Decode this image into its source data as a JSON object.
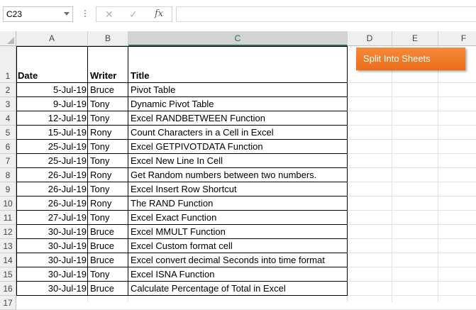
{
  "formula_bar": {
    "name_box": "C23",
    "cancel_icon": "close-icon",
    "enter_icon": "check-icon",
    "fx_label": "fx",
    "formula": ""
  },
  "columns": [
    "A",
    "B",
    "C",
    "D",
    "E",
    "F"
  ],
  "rows": [
    "1",
    "2",
    "3",
    "4",
    "5",
    "6",
    "7",
    "8",
    "9",
    "10",
    "11",
    "12",
    "13",
    "14",
    "15",
    "16",
    "17"
  ],
  "table": {
    "headers": {
      "date": "Date",
      "writer": "Writer",
      "title": "Title"
    },
    "records": [
      {
        "date": "5-Jul-19",
        "writer": "Bruce",
        "title": "Pivot Table"
      },
      {
        "date": "9-Jul-19",
        "writer": "Tony",
        "title": "Dynamic Pivot Table"
      },
      {
        "date": "12-Jul-19",
        "writer": "Tony",
        "title": "Excel RANDBETWEEN Function"
      },
      {
        "date": "15-Jul-19",
        "writer": "Rony",
        "title": "Count Characters in a Cell in Excel"
      },
      {
        "date": "25-Jul-19",
        "writer": "Tony",
        "title": "Excel GETPIVOTDATA Function"
      },
      {
        "date": "25-Jul-19",
        "writer": "Tony",
        "title": "Excel New Line In Cell"
      },
      {
        "date": "26-Jul-19",
        "writer": "Rony",
        "title": "Get Random numbers between two numbers."
      },
      {
        "date": "26-Jul-19",
        "writer": "Tony",
        "title": "Excel Insert Row Shortcut"
      },
      {
        "date": "26-Jul-19",
        "writer": "Rony",
        "title": "The RAND Function"
      },
      {
        "date": "27-Jul-19",
        "writer": "Tony",
        "title": "Excel Exact Function"
      },
      {
        "date": "30-Jul-19",
        "writer": "Bruce",
        "title": "Excel MMULT Function"
      },
      {
        "date": "30-Jul-19",
        "writer": "Bruce",
        "title": "Excel Custom format cell"
      },
      {
        "date": "30-Jul-19",
        "writer": "Bruce",
        "title": "Excel convert decimal Seconds into time format"
      },
      {
        "date": "30-Jul-19",
        "writer": "Tony",
        "title": "Excel ISNA Function"
      },
      {
        "date": "30-Jul-19",
        "writer": "Bruce",
        "title": "Calculate Percentage of Total in Excel"
      }
    ]
  },
  "split_button": {
    "label": "Split Into Sheets",
    "color": "#ef7422"
  },
  "selected_column": "C",
  "accent": "#217346"
}
